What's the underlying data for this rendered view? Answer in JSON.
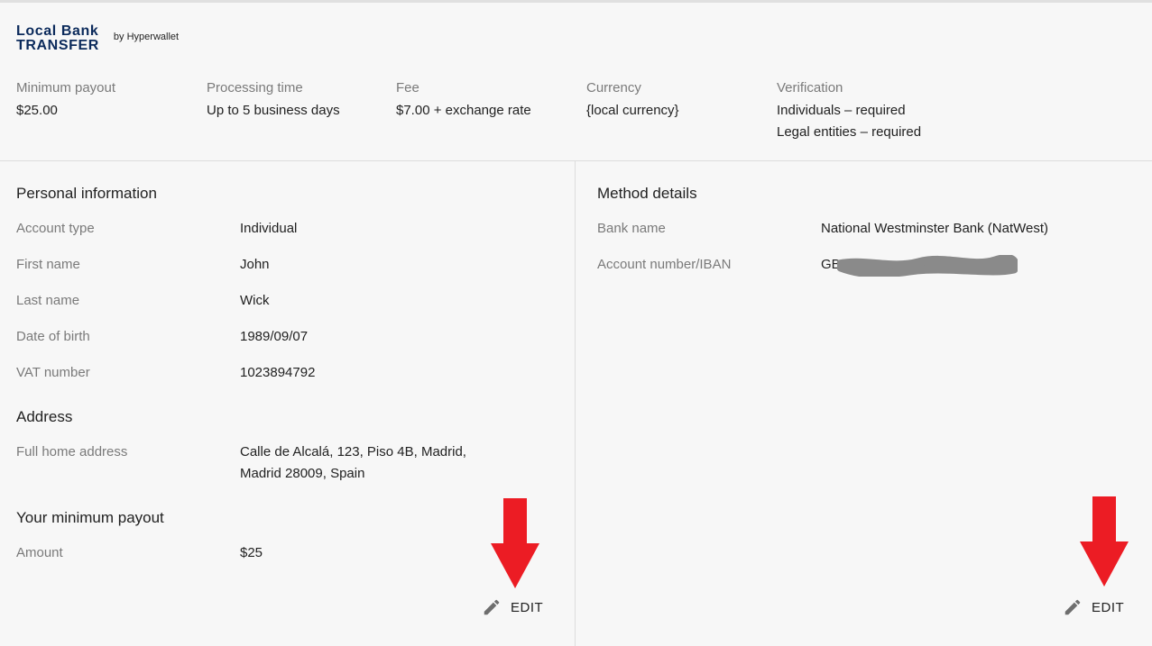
{
  "header": {
    "logo": {
      "line1": "Local Bank",
      "line2": "TRANSFER",
      "by": "by Hyperwallet"
    },
    "summary": [
      {
        "label": "Minimum payout",
        "value": "$25.00"
      },
      {
        "label": "Processing time",
        "value": "Up to 5 business days"
      },
      {
        "label": "Fee",
        "value": "$7.00 + exchange rate"
      },
      {
        "label": "Currency",
        "value": "{local currency}"
      },
      {
        "label": "Verification",
        "lines": [
          "Individuals – required",
          "Legal entities – required"
        ]
      }
    ]
  },
  "personal": {
    "title": "Personal information",
    "fields": [
      {
        "label": "Account type",
        "value": "Individual"
      },
      {
        "label": "First name",
        "value": "John"
      },
      {
        "label": "Last name",
        "value": "Wick"
      },
      {
        "label": "Date of birth",
        "value": "1989/09/07"
      },
      {
        "label": "VAT number",
        "value": "1023894792"
      }
    ]
  },
  "address": {
    "title": "Address",
    "label": "Full home address",
    "line1": "Calle de Alcalá, 123, Piso 4B, Madrid,",
    "line2": "Madrid 28009, Spain"
  },
  "min_payout": {
    "title": "Your minimum payout",
    "label": "Amount",
    "value": "$25"
  },
  "method": {
    "title": "Method details",
    "fields": [
      {
        "label": "Bank name",
        "value": "National Westminster Bank (NatWest)"
      },
      {
        "label": "Account number/IBAN",
        "value": "GB"
      }
    ]
  },
  "actions": {
    "edit_label": "EDIT"
  },
  "colors": {
    "brand": "#0b2a5b",
    "arrow": "#ec1c24",
    "redaction": "#8a8a8a"
  }
}
